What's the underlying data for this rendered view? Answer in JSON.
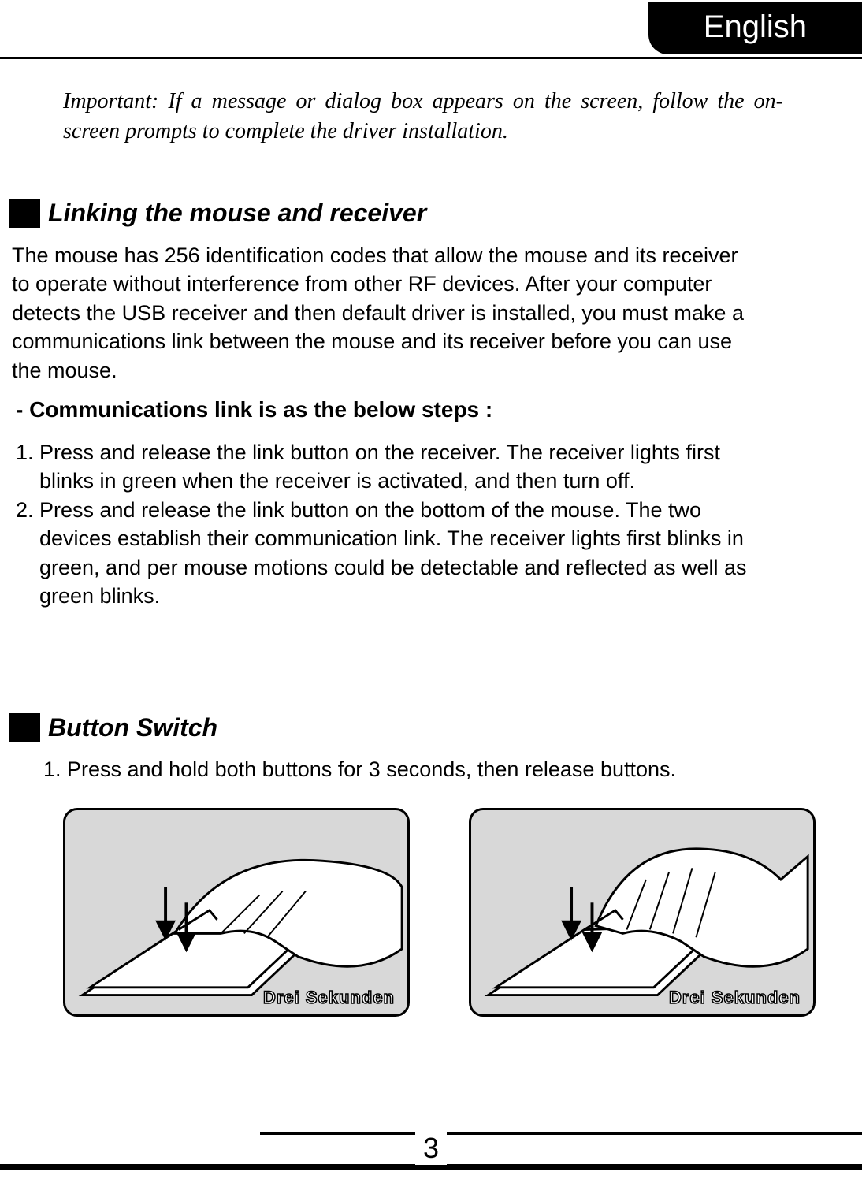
{
  "language_tab": "English",
  "important_note": "Important: If a message or dialog box appears on the screen, follow the on-screen prompts to complete the driver installation.",
  "section1": {
    "heading": "Linking the mouse and receiver",
    "body": "The mouse has 256 identification codes that allow the mouse and its receiver to operate without interference from other RF devices. After your computer detects the USB receiver and then default driver is installed, you must make a communications link between the mouse and its receiver before you can use the mouse.",
    "sub_heading": "- Communications link is as the below steps :",
    "steps": [
      "Press and release the link button on the receiver. The receiver lights first blinks in green when the receiver is activated, and then turn off.",
      "Press and release the link button on the bottom of the mouse. The two devices establish their communication link. The receiver lights first blinks in green, and per mouse motions could be detectable and reflected as well as green blinks."
    ]
  },
  "section2": {
    "heading": "Button Switch",
    "steps": [
      "Press and hold both buttons for 3 seconds, then release buttons."
    ]
  },
  "illustration_label": "Drei Sekunden",
  "page_number": "3"
}
